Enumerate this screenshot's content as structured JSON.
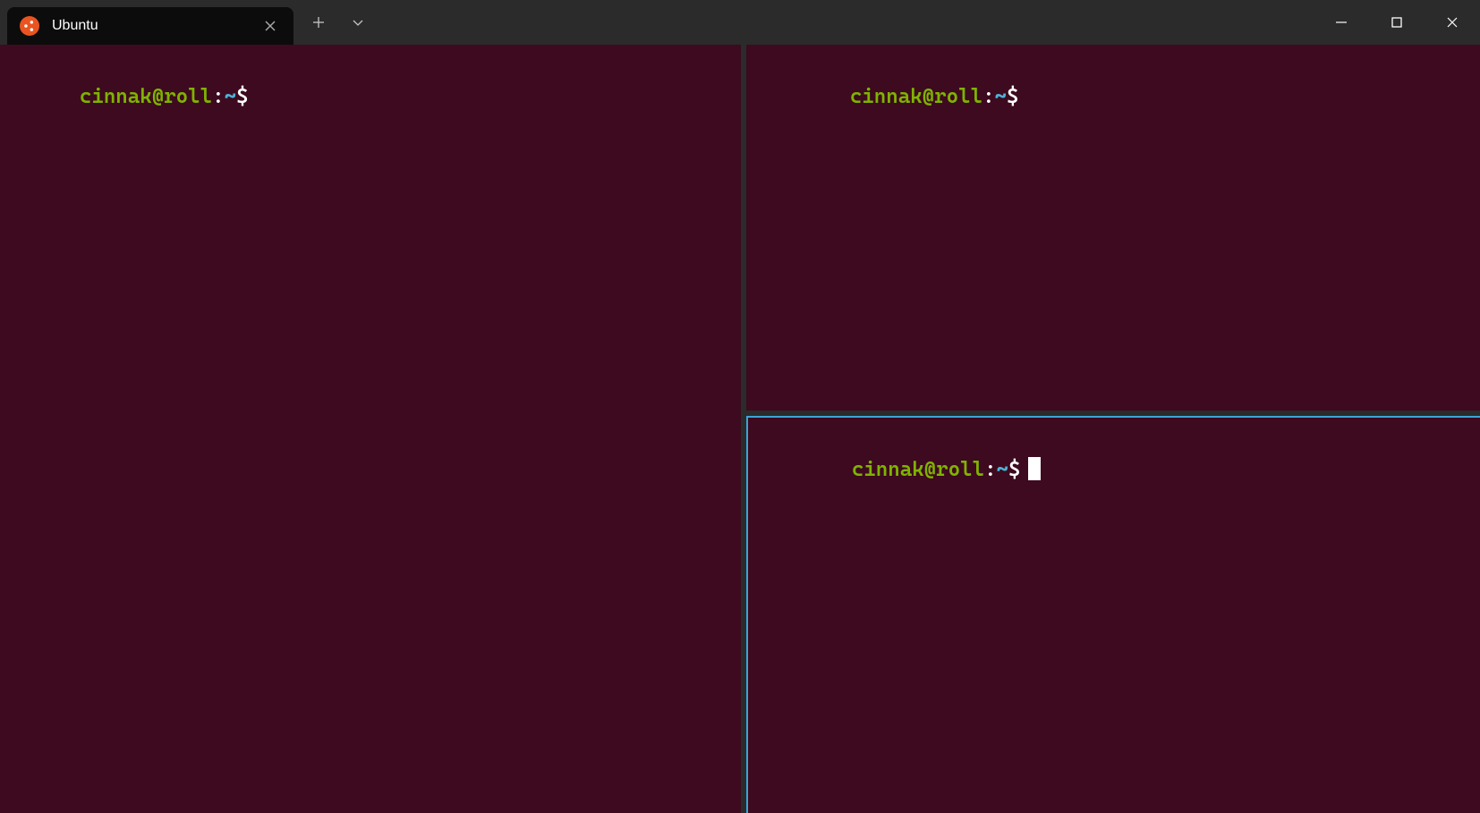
{
  "tab": {
    "title": "Ubuntu"
  },
  "panes": {
    "left": {
      "user_host": "cinnak@roll",
      "path": "~",
      "dollar": "$"
    },
    "top_right": {
      "user_host": "cinnak@roll",
      "path": "~",
      "dollar": "$"
    },
    "bottom_right": {
      "user_host": "cinnak@roll",
      "path": "~",
      "dollar": "$",
      "active": true
    }
  },
  "colors": {
    "terminal_bg": "#3d0a1f",
    "prompt_user": "#7fb301",
    "prompt_path": "#4db3d5",
    "active_border": "#3ba4d8",
    "ubuntu_orange": "#e95420"
  }
}
